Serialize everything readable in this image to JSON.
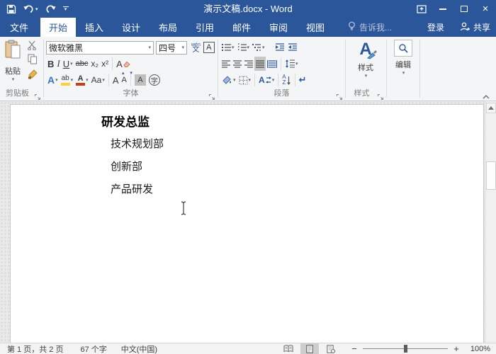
{
  "titlebar": {
    "title": "演示文稿.docx - Word"
  },
  "tabs": {
    "file": "文件",
    "home": "开始",
    "items": [
      "插入",
      "设计",
      "布局",
      "引用",
      "邮件",
      "审阅",
      "视图"
    ],
    "tell_me": "告诉我...",
    "sign_in": "登录",
    "share": "共享"
  },
  "ribbon": {
    "clipboard": {
      "label": "剪贴板",
      "paste": "粘贴"
    },
    "font": {
      "label": "字体",
      "name": "微软雅黑",
      "size": "四号",
      "bold": "B",
      "italic": "I",
      "underline": "U",
      "strikethrough": "abc",
      "subscript": "x₂",
      "superscript": "x²",
      "phonetic_ruby": "wén",
      "phonetic_char": "文",
      "char_border": "A",
      "clear_format": "A",
      "text_effects": "A",
      "highlight": "ab",
      "font_color": "A",
      "change_case": "Aa",
      "grow": "A",
      "shrink": "A",
      "char_shading": "A",
      "enclose": "字"
    },
    "paragraph": {
      "label": "段落",
      "sort_top": "A",
      "sort_bottom": "Z",
      "pilcrow": "↵",
      "asian": "A"
    },
    "styles": {
      "label": "样式",
      "button": "样式",
      "icon": "A"
    },
    "editing": {
      "button": "编辑"
    }
  },
  "document": {
    "heading": "研发总监",
    "lines": [
      "技术规划部",
      "创新部",
      "产品研发"
    ]
  },
  "statusbar": {
    "page_info": "第 1 页，共 2 页",
    "word_count": "67 个字",
    "language": "中文(中国)",
    "zoom_level": "100%"
  },
  "colors": {
    "accent": "#2b579a",
    "highlight_yellow": "#f7d23e",
    "font_color_red": "#c43e1c",
    "effects_blue": "#3b76c4"
  }
}
